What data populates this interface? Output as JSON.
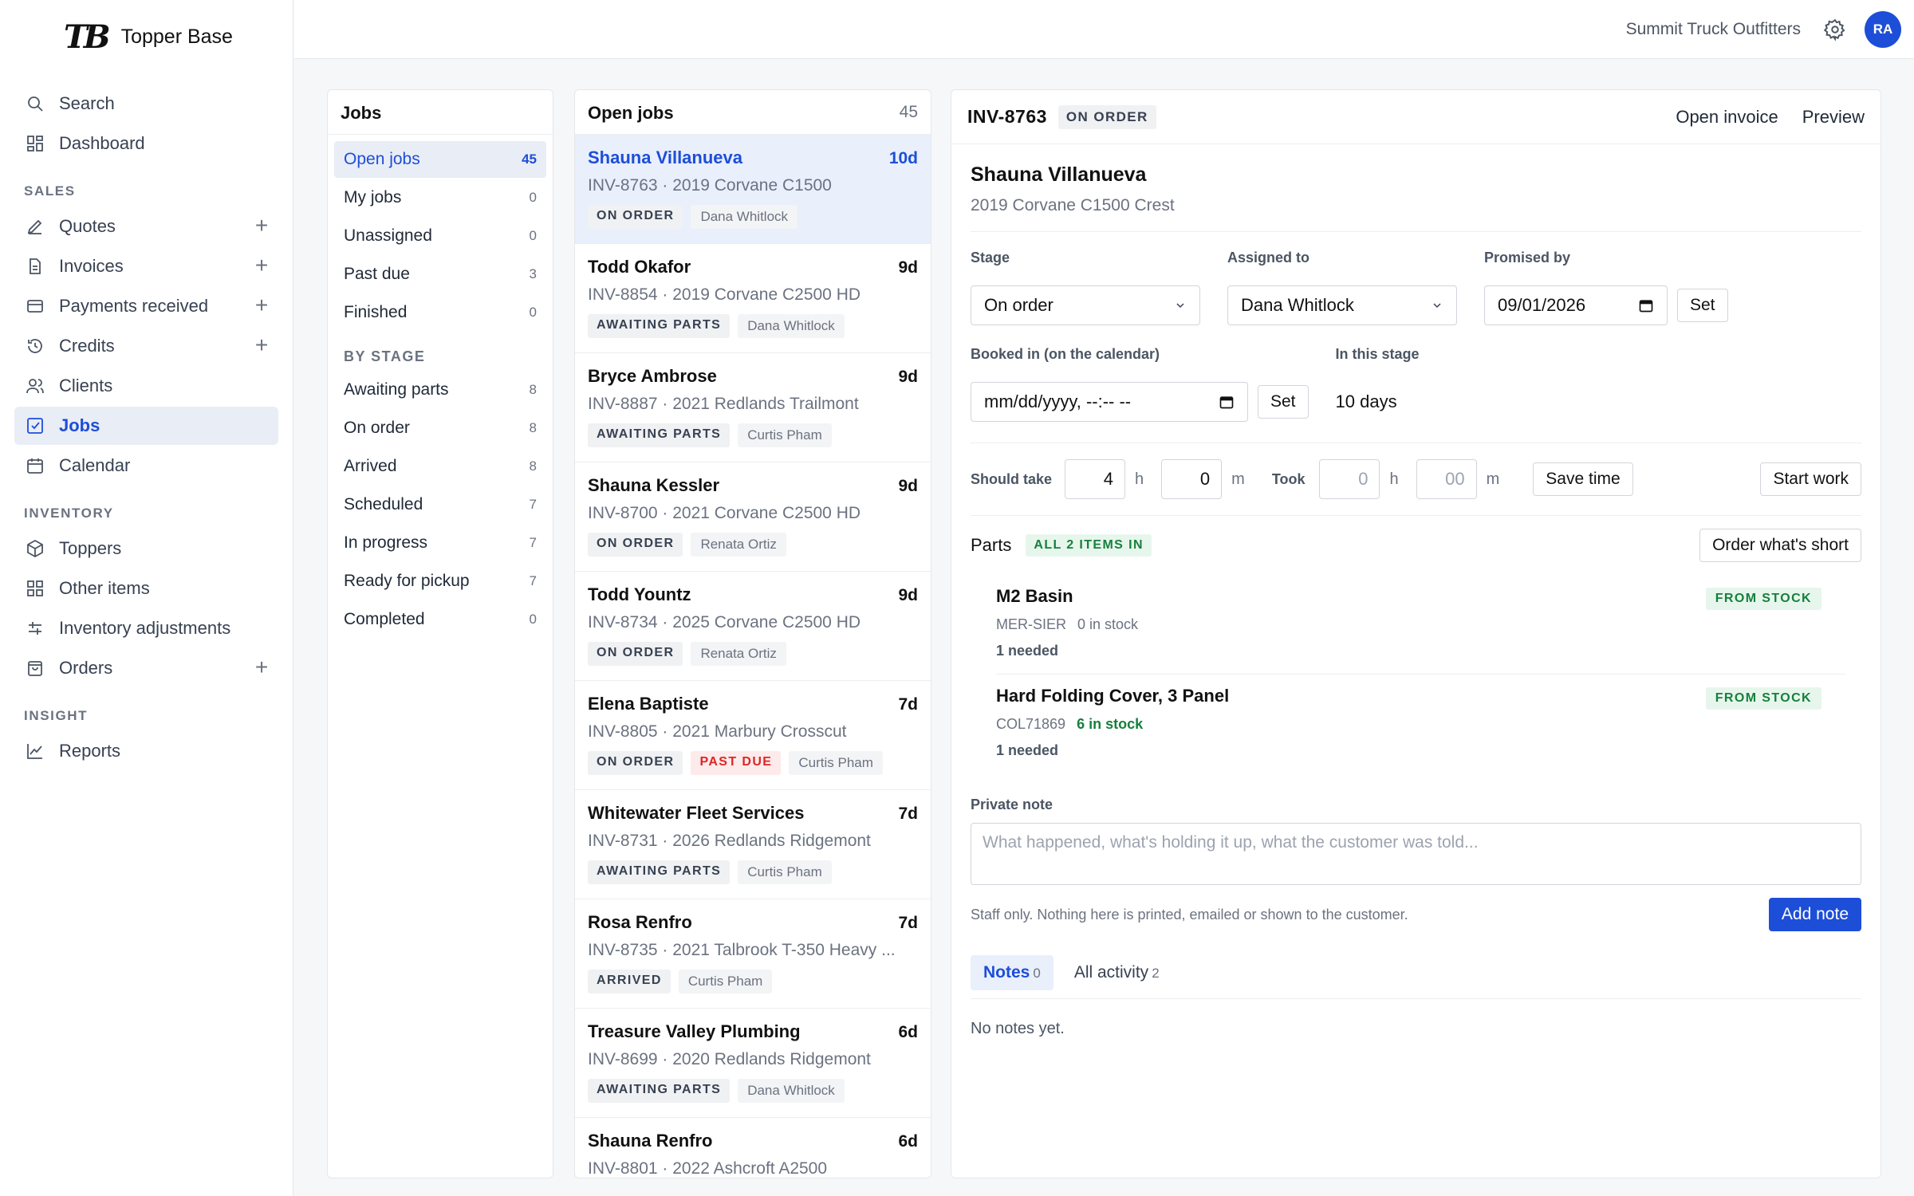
{
  "app": {
    "logo_mark": "TB",
    "name": "Topper Base"
  },
  "sidebar": {
    "top": [
      {
        "label": "Search",
        "icon": "search-icon"
      },
      {
        "label": "Dashboard",
        "icon": "dashboard-icon"
      }
    ],
    "sales_label": "SALES",
    "sales": [
      {
        "label": "Quotes",
        "icon": "pen-icon"
      },
      {
        "label": "Invoices",
        "icon": "document-icon"
      },
      {
        "label": "Payments received",
        "icon": "card-icon"
      },
      {
        "label": "Credits",
        "icon": "history-icon"
      },
      {
        "label": "Clients",
        "icon": "users-icon"
      },
      {
        "label": "Jobs",
        "icon": "checkbox-icon"
      },
      {
        "label": "Calendar",
        "icon": "calendar-icon"
      }
    ],
    "inventory_label": "INVENTORY",
    "inventory": [
      {
        "label": "Toppers",
        "icon": "box-icon"
      },
      {
        "label": "Other items",
        "icon": "grid-icon"
      },
      {
        "label": "Inventory adjustments",
        "icon": "sliders-icon"
      },
      {
        "label": "Orders",
        "icon": "bag-icon"
      }
    ],
    "insight_label": "INSIGHT",
    "insight": [
      {
        "label": "Reports",
        "icon": "chart-icon"
      }
    ]
  },
  "topbar": {
    "company": "Summit Truck Outfitters",
    "avatar": "RA"
  },
  "jobs_panel": {
    "title": "Jobs",
    "filters": [
      {
        "label": "Open jobs",
        "count": "45"
      },
      {
        "label": "My jobs",
        "count": "0"
      },
      {
        "label": "Unassigned",
        "count": "0"
      },
      {
        "label": "Past due",
        "count": "3"
      },
      {
        "label": "Finished",
        "count": "0"
      }
    ],
    "stage_label": "BY STAGE",
    "stages": [
      {
        "label": "Awaiting parts",
        "count": "8"
      },
      {
        "label": "On order",
        "count": "8"
      },
      {
        "label": "Arrived",
        "count": "8"
      },
      {
        "label": "Scheduled",
        "count": "7"
      },
      {
        "label": "In progress",
        "count": "7"
      },
      {
        "label": "Ready for pickup",
        "count": "7"
      },
      {
        "label": "Completed",
        "count": "0"
      }
    ]
  },
  "open_jobs": {
    "title": "Open jobs",
    "count": "45",
    "items": [
      {
        "name": "Shauna Villanueva",
        "age": "10d",
        "inv": "INV-8763 · 2019 Corvane C1500",
        "tags": [
          "ON ORDER"
        ],
        "person": "Dana Whitlock"
      },
      {
        "name": "Todd Okafor",
        "age": "9d",
        "inv": "INV-8854 · 2019 Corvane C2500 HD",
        "tags": [
          "AWAITING PARTS"
        ],
        "person": "Dana Whitlock"
      },
      {
        "name": "Bryce Ambrose",
        "age": "9d",
        "inv": "INV-8887 · 2021 Redlands Trailmont",
        "tags": [
          "AWAITING PARTS"
        ],
        "person": "Curtis Pham"
      },
      {
        "name": "Shauna Kessler",
        "age": "9d",
        "inv": "INV-8700 · 2021 Corvane C2500 HD",
        "tags": [
          "ON ORDER"
        ],
        "person": "Renata Ortiz"
      },
      {
        "name": "Todd Yountz",
        "age": "9d",
        "inv": "INV-8734 · 2025 Corvane C2500 HD",
        "tags": [
          "ON ORDER"
        ],
        "person": "Renata Ortiz"
      },
      {
        "name": "Elena Baptiste",
        "age": "7d",
        "inv": "INV-8805 · 2021 Marbury Crosscut",
        "tags": [
          "ON ORDER",
          "PAST DUE"
        ],
        "person": "Curtis Pham"
      },
      {
        "name": "Whitewater Fleet Services",
        "age": "7d",
        "inv": "INV-8731 · 2026 Redlands Ridgemont",
        "tags": [
          "AWAITING PARTS"
        ],
        "person": "Curtis Pham"
      },
      {
        "name": "Rosa Renfro",
        "age": "7d",
        "inv": "INV-8735 · 2021 Talbrook T-350 Heavy ...",
        "tags": [
          "ARRIVED"
        ],
        "person": "Curtis Pham"
      },
      {
        "name": "Treasure Valley Plumbing",
        "age": "6d",
        "inv": "INV-8699 · 2020 Redlands Ridgemont",
        "tags": [
          "AWAITING PARTS"
        ],
        "person": "Dana Whitlock"
      },
      {
        "name": "Shauna Renfro",
        "age": "6d",
        "inv": "INV-8801 · 2022 Ashcroft A2500",
        "tags": [],
        "person": ""
      }
    ]
  },
  "detail": {
    "invoice": "INV-8763",
    "status": "ON ORDER",
    "open_invoice": "Open invoice",
    "preview": "Preview",
    "customer": "Shauna Villanueva",
    "vehicle": "2019 Corvane C1500 Crest",
    "stage_label": "Stage",
    "stage_value": "On order",
    "assigned_label": "Assigned to",
    "assigned_value": "Dana Whitlock",
    "promised_label": "Promised by",
    "promised_value": "09/01/2026",
    "set_label": "Set",
    "booked_label": "Booked in (on the calendar)",
    "booked_value": "mm/dd/yyyy, --:-- --",
    "in_stage_label": "In this stage",
    "in_stage_value": "10 days",
    "should_take_label": "Should take",
    "should_h": "4",
    "should_m": "0",
    "h": "h",
    "m": "m",
    "took_label": "Took",
    "took_h_placeholder": "0",
    "took_m_placeholder": "00",
    "save_time": "Save time",
    "start_work": "Start work",
    "parts_title": "Parts",
    "parts_badge": "ALL 2 ITEMS IN",
    "order_short": "Order what's short",
    "parts": [
      {
        "name": "M2 Basin",
        "sku": "MER-SIER",
        "stock": "0 in stock",
        "need": "1 needed",
        "source": "FROM STOCK"
      },
      {
        "name": "Hard Folding Cover, 3 Panel",
        "sku": "COL71869",
        "stock": "6 in stock",
        "need": "1 needed",
        "source": "FROM STOCK"
      }
    ],
    "note_label": "Private note",
    "note_placeholder": "What happened, what's holding it up, what the customer was told...",
    "note_hint": "Staff only. Nothing here is printed, emailed or shown to the customer.",
    "add_note": "Add note",
    "tab_notes": "Notes",
    "tab_notes_count": "0",
    "tab_activity": "All activity",
    "tab_activity_count": "2",
    "empty": "No notes yet."
  }
}
